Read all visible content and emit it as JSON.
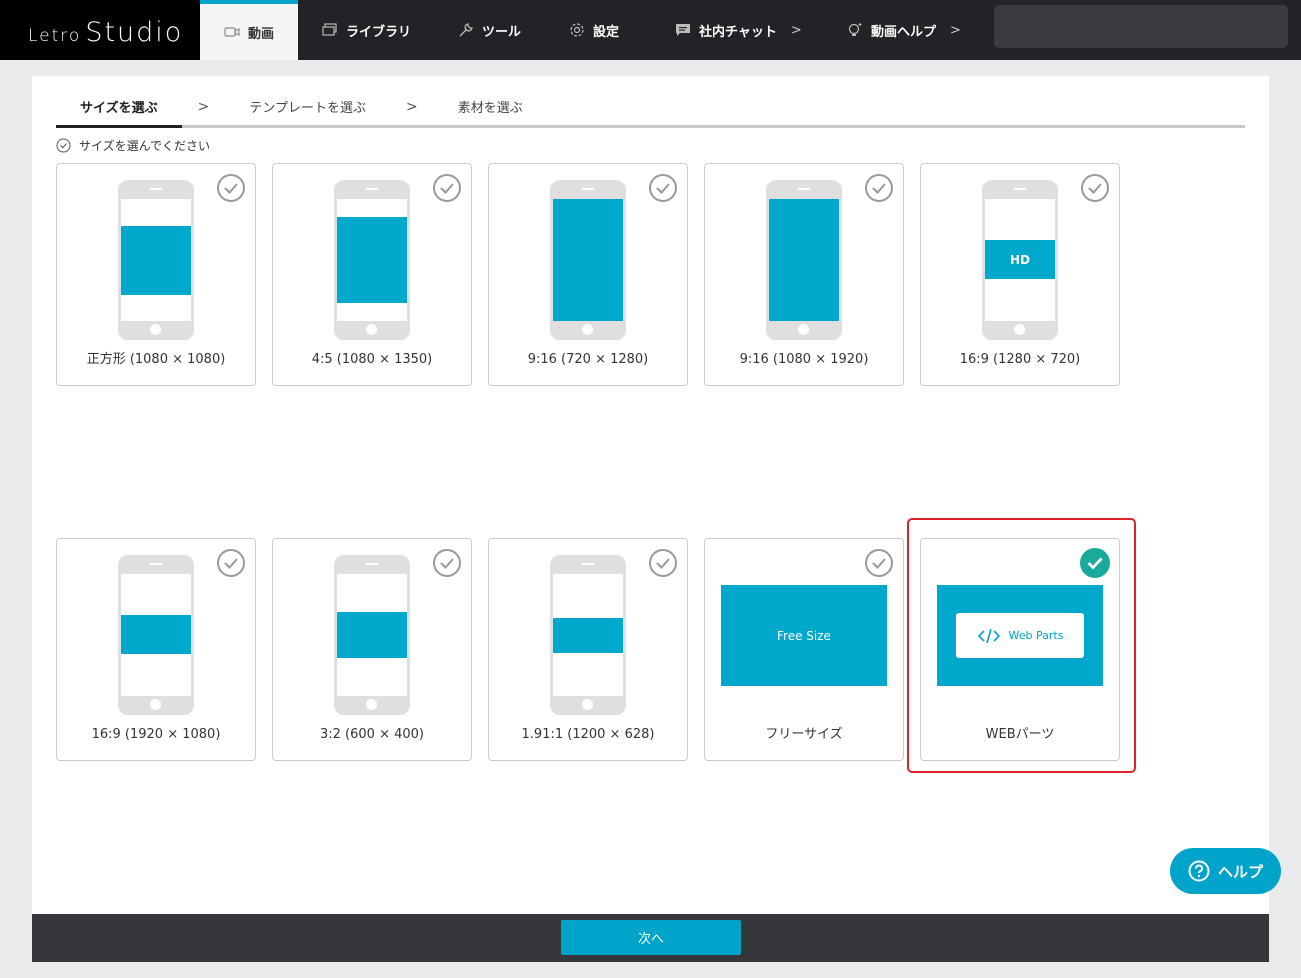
{
  "app": {
    "logo_small": "Letro",
    "logo_large": "Studio"
  },
  "nav": {
    "items": [
      {
        "label": "動画",
        "icon": "video-icon"
      },
      {
        "label": "ライブラリ",
        "icon": "library-icon"
      },
      {
        "label": "ツール",
        "icon": "wrench-icon"
      },
      {
        "label": "設定",
        "icon": "gear-icon"
      },
      {
        "label": "社内チャット",
        "icon": "chat-icon"
      },
      {
        "label": "動画ヘルプ",
        "icon": "lightbulb-icon"
      }
    ],
    "chevron": ">"
  },
  "steps": {
    "items": [
      "サイズを選ぶ",
      "テンプレートを選ぶ",
      "素材を選ぶ"
    ],
    "separator": ">"
  },
  "hint": "サイズを選んでください",
  "sizes": [
    {
      "label": "正方形 (1080 × 1080)"
    },
    {
      "label": "4:5 (1080 × 1350)"
    },
    {
      "label": "9:16 (720 × 1280)"
    },
    {
      "label": "9:16 (1080 × 1920)"
    },
    {
      "label": "16:9 (1280 × 720)",
      "badge": "HD"
    },
    {
      "label": "16:9 (1920 × 1080)"
    },
    {
      "label": "3:2 (600 × 400)"
    },
    {
      "label": "1.91:1 (1200 × 628)"
    },
    {
      "label": "フリーサイズ",
      "preview_text": "Free Size"
    },
    {
      "label": "WEBパーツ",
      "preview_text": "Web Parts",
      "selected": true
    }
  ],
  "footer": {
    "next_label": "次へ"
  },
  "help": {
    "label": "ヘルプ"
  },
  "colors": {
    "accent": "#00a3c9",
    "selection": "#e0222b",
    "check_selected": "#1aaa9b"
  }
}
